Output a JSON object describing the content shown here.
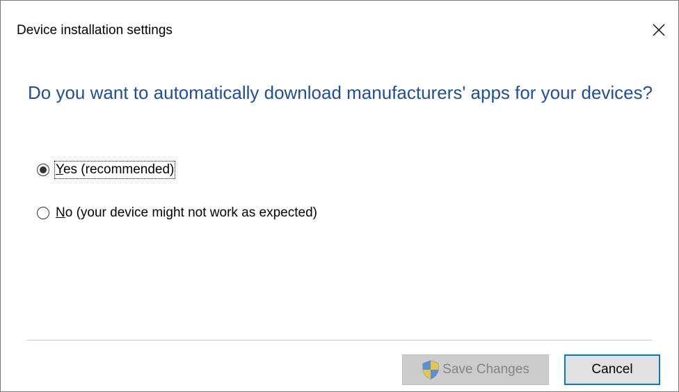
{
  "window": {
    "title": "Device installation settings"
  },
  "prompt": {
    "question": "Do you want to automatically download manufacturers' apps for your devices?"
  },
  "options": [
    {
      "mnemonic": "Y",
      "rest": "es (recommended)",
      "selected": true
    },
    {
      "mnemonic": "N",
      "rest": "o (your device might not work as expected)",
      "selected": false
    }
  ],
  "buttons": {
    "save_label": "Save Changes",
    "save_enabled": false,
    "cancel_label": "Cancel"
  },
  "icons": {
    "close": "close-icon",
    "shield": "uac-shield-icon"
  },
  "colors": {
    "headline": "#1f4e9b",
    "focus_border": "#0078d7",
    "disabled_bg": "#cccccc",
    "disabled_text": "#838383"
  }
}
